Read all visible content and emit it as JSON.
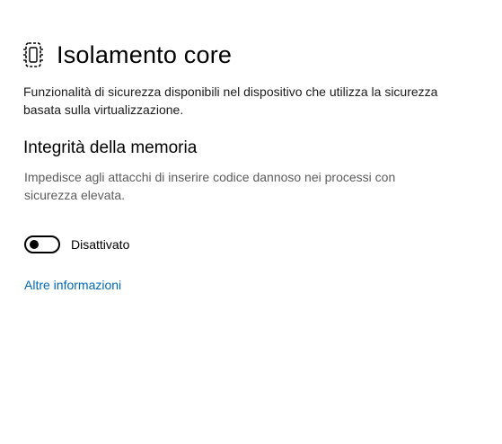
{
  "header": {
    "icon": "core-isolation-chip-icon",
    "title": "Isolamento core"
  },
  "description": "Funzionalità di sicurezza disponibili nel dispositivo che utilizza la sicurezza basata sulla virtualizzazione.",
  "memory_integrity": {
    "title": "Integrità della memoria",
    "description": "Impedisce agli attacchi di inserire codice dannoso nei processi con sicurezza elevata.",
    "toggle": {
      "state": "off",
      "label": "Disattivato"
    }
  },
  "more_info_link": "Altre informazioni",
  "colors": {
    "link": "#0067b8",
    "secondary_text": "#5c5c5c",
    "toggle_off": "#000000"
  }
}
